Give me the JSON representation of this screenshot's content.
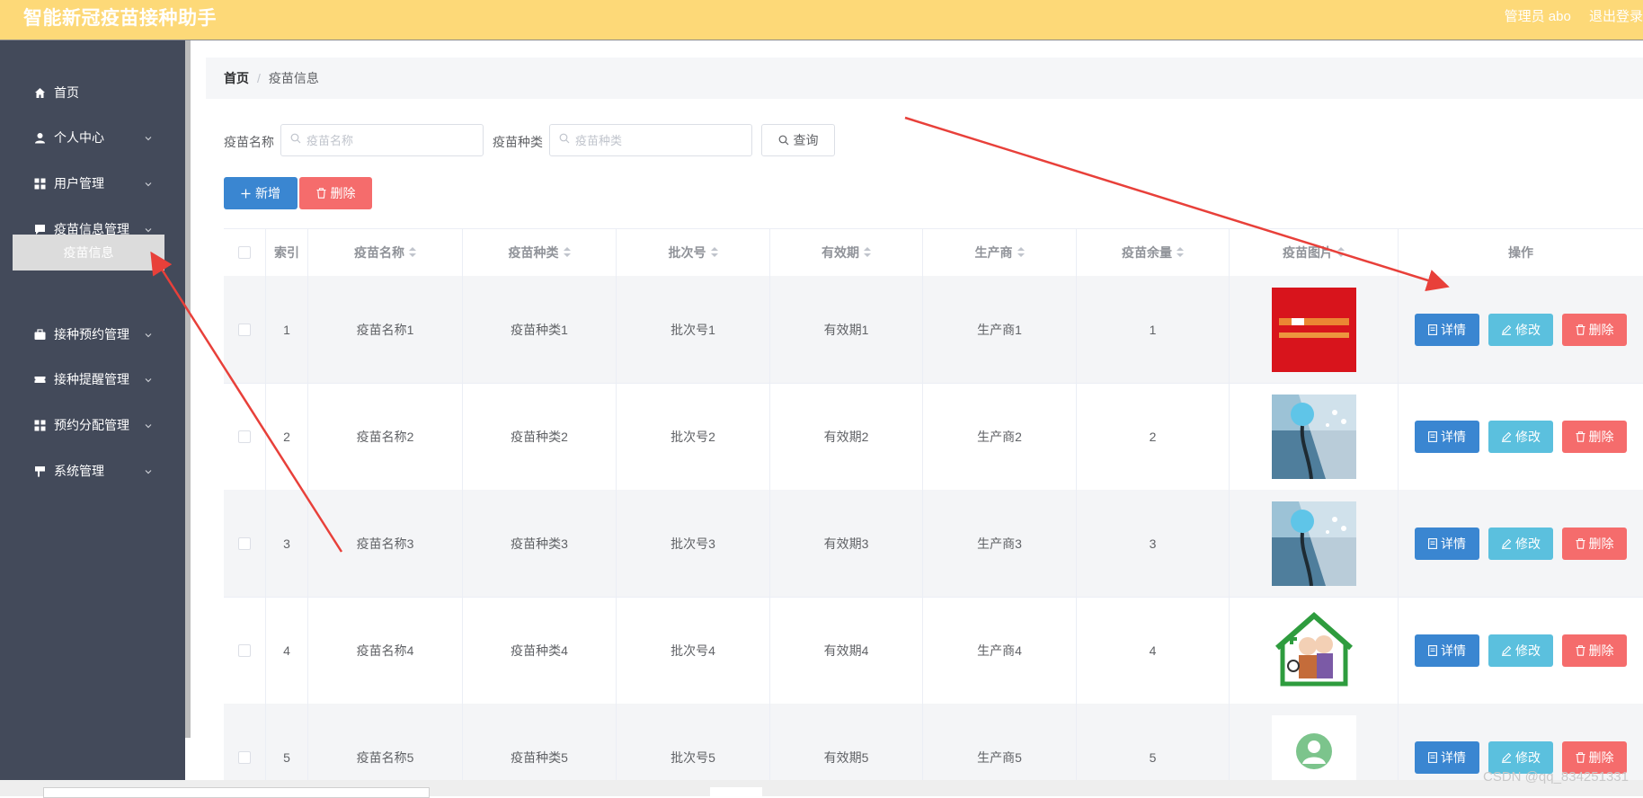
{
  "app": {
    "title": "智能新冠疫苗接种助手"
  },
  "topbar": {
    "user": "管理员 abo",
    "logout": "退出登录"
  },
  "sidebar": {
    "items": [
      {
        "label": "首页",
        "icon": "home-icon"
      },
      {
        "label": "个人中心",
        "icon": "user-icon"
      },
      {
        "label": "用户管理",
        "icon": "grid-icon"
      },
      {
        "label": "疫苗信息管理",
        "icon": "message-icon"
      },
      {
        "label": "接种预约管理",
        "icon": "briefcase-icon"
      },
      {
        "label": "接种提醒管理",
        "icon": "ticket-icon"
      },
      {
        "label": "预约分配管理",
        "icon": "grid-icon"
      },
      {
        "label": "系统管理",
        "icon": "flag-icon"
      }
    ],
    "active_sub": "疫苗信息"
  },
  "breadcrumb": {
    "home": "首页",
    "separator": "/",
    "current": "疫苗信息"
  },
  "search": {
    "name_label": "疫苗名称",
    "name_placeholder": "疫苗名称",
    "type_label": "疫苗种类",
    "type_placeholder": "疫苗种类",
    "query_button": "查询"
  },
  "toolbar": {
    "add": "新增",
    "delete": "删除"
  },
  "table": {
    "headers": [
      "索引",
      "疫苗名称",
      "疫苗种类",
      "批次号",
      "有效期",
      "生产商",
      "疫苗余量",
      "疫苗图片",
      "操作"
    ],
    "rows": [
      {
        "index": "1",
        "name": "疫苗名称1",
        "type": "疫苗种类1",
        "batch": "批次号1",
        "expiry": "有效期1",
        "maker": "生产商1",
        "stock": "1",
        "image": "red-banner-image"
      },
      {
        "index": "2",
        "name": "疫苗名称2",
        "type": "疫苗种类2",
        "batch": "批次号2",
        "expiry": "有效期2",
        "maker": "生产商2",
        "stock": "2",
        "image": "stethoscope-image"
      },
      {
        "index": "3",
        "name": "疫苗名称3",
        "type": "疫苗种类3",
        "batch": "批次号3",
        "expiry": "有效期3",
        "maker": "生产商3",
        "stock": "3",
        "image": "stethoscope-image"
      },
      {
        "index": "4",
        "name": "疫苗名称4",
        "type": "疫苗种类4",
        "batch": "批次号4",
        "expiry": "有效期4",
        "maker": "生产商4",
        "stock": "4",
        "image": "elderly-couple-image"
      },
      {
        "index": "5",
        "name": "疫苗名称5",
        "type": "疫苗种类5",
        "batch": "批次号5",
        "expiry": "有效期5",
        "maker": "生产商5",
        "stock": "5",
        "image": "doctor-avatar-image"
      }
    ],
    "actions": {
      "detail": "详情",
      "edit": "修改",
      "delete": "删除"
    }
  },
  "watermark": "CSDN @qq_834251331",
  "colors": {
    "topbar": "#fdd978",
    "sidebar": "#434a5a",
    "primary": "#3a86d1",
    "info": "#5bc0de",
    "danger": "#f56c6c",
    "arrow": "#e8403a"
  }
}
